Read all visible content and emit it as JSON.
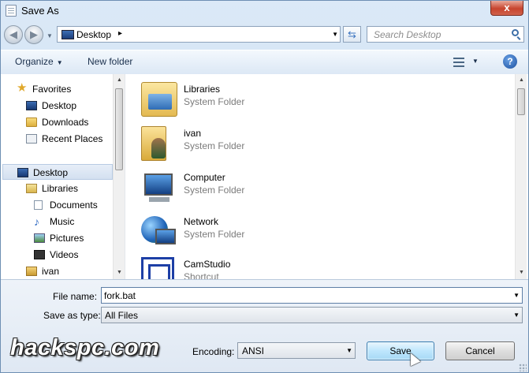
{
  "window": {
    "title": "Save As",
    "close_glyph": "x"
  },
  "address_bar": {
    "breadcrumb": "Desktop",
    "breadcrumb_separator": "▸",
    "search_placeholder": "Search Desktop"
  },
  "toolbar": {
    "organize_label": "Organize",
    "new_folder_label": "New folder",
    "help_glyph": "?"
  },
  "nav_pane": {
    "items": [
      {
        "label": "Favorites",
        "icon": "star-icon"
      },
      {
        "label": "Desktop",
        "icon": "desktop-icon"
      },
      {
        "label": "Downloads",
        "icon": "downloads-folder-icon"
      },
      {
        "label": "Recent Places",
        "icon": "recent-places-icon"
      },
      {
        "label": "Desktop",
        "icon": "desktop-icon"
      },
      {
        "label": "Libraries",
        "icon": "libraries-icon"
      },
      {
        "label": "Documents",
        "icon": "documents-icon"
      },
      {
        "label": "Music",
        "icon": "music-icon"
      },
      {
        "label": "Pictures",
        "icon": "pictures-icon"
      },
      {
        "label": "Videos",
        "icon": "videos-icon"
      },
      {
        "label": "ivan",
        "icon": "user-folder-icon"
      }
    ]
  },
  "files": [
    {
      "name": "Libraries",
      "type": "System Folder",
      "icon": "libraries-icon"
    },
    {
      "name": "ivan",
      "type": "System Folder",
      "icon": "user-folder-icon"
    },
    {
      "name": "Computer",
      "type": "System Folder",
      "icon": "computer-icon"
    },
    {
      "name": "Network",
      "type": "System Folder",
      "icon": "network-icon"
    },
    {
      "name": "CamStudio",
      "type": "Shortcut",
      "icon": "camstudio-icon"
    }
  ],
  "form": {
    "file_name_label": "File name:",
    "file_name_value": "fork.bat",
    "save_as_type_label": "Save as type:",
    "save_as_type_value": "All Files",
    "encoding_label": "Encoding:",
    "encoding_value": "ANSI",
    "save_label": "Save",
    "cancel_label": "Cancel"
  },
  "watermark": "hackspc.com",
  "colors": {
    "accent": "#3c7fb1",
    "close": "#c7442e"
  }
}
